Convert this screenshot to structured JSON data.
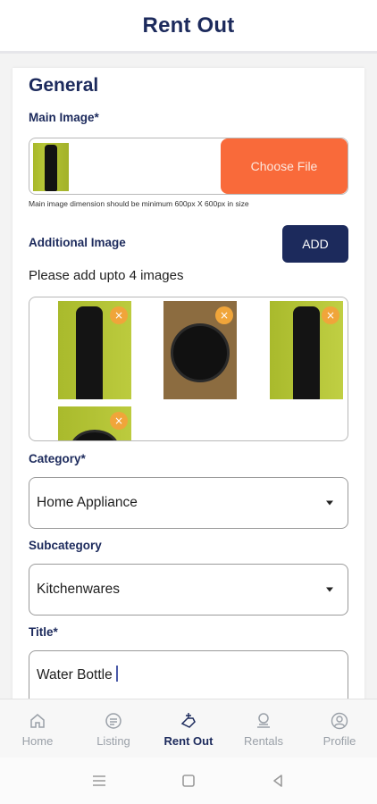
{
  "header": {
    "title": "Rent Out"
  },
  "form": {
    "section_title": "General",
    "main_image": {
      "label": "Main Image*",
      "button_label": "Choose File",
      "hint": "Main image dimension should be minimum 600px X 600px in size"
    },
    "additional_image": {
      "label": "Additional Image",
      "add_button_label": "ADD",
      "instruction": "Please add upto 4 images",
      "remove_icon": "×"
    },
    "category": {
      "label": "Category*",
      "value": "Home Appliance"
    },
    "subcategory": {
      "label": "Subcategory",
      "value": "Kitchenwares"
    },
    "title": {
      "label": "Title*",
      "value": "Water Bottle"
    }
  },
  "tabs": [
    {
      "label": "Home",
      "icon": "home-icon",
      "active": false
    },
    {
      "label": "Listing",
      "icon": "listing-icon",
      "active": false
    },
    {
      "label": "Rent Out",
      "icon": "rent-out-icon",
      "active": true
    },
    {
      "label": "Rentals",
      "icon": "rentals-icon",
      "active": false
    },
    {
      "label": "Profile",
      "icon": "profile-icon",
      "active": false
    }
  ],
  "colors": {
    "primary": "#1c2a5c",
    "accent": "#f96a3a",
    "remove_badge": "#f0a53a"
  }
}
